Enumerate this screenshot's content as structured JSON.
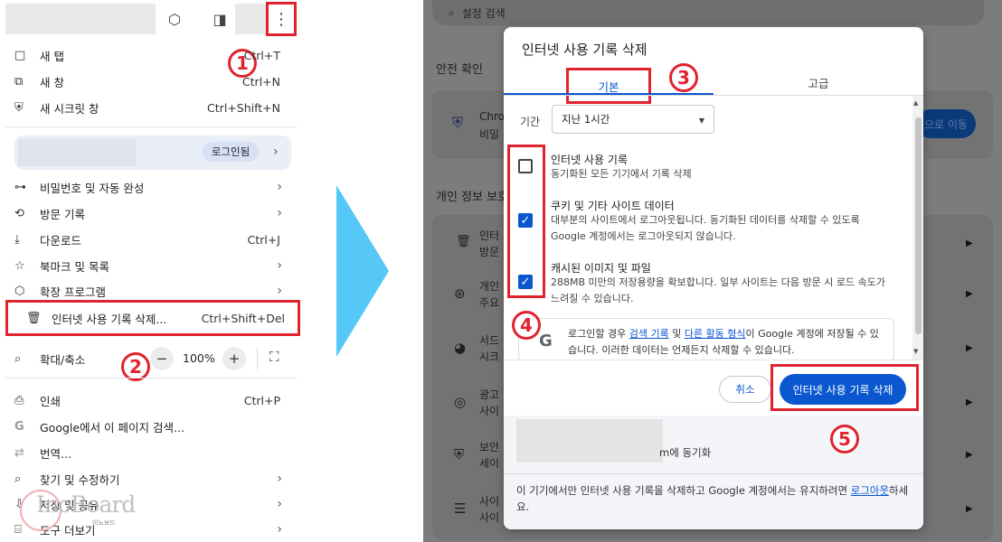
{
  "menu": {
    "items": [
      {
        "icon": "□",
        "label": "새 탭",
        "shortcut": "Ctrl+T"
      },
      {
        "icon": "⧉",
        "label": "새 창",
        "shortcut": "Ctrl+N"
      },
      {
        "icon": "⛨",
        "label": "새 시크릿 창",
        "shortcut": "Ctrl+Shift+N"
      },
      {
        "icon": "⊶",
        "label": "비밀번호 및 자동 완성",
        "shortcut": ""
      },
      {
        "icon": "⟲",
        "label": "방문 기록",
        "shortcut": ""
      },
      {
        "icon": "⤓",
        "label": "다운로드",
        "shortcut": "Ctrl+J"
      },
      {
        "icon": "☆",
        "label": "북마크 및 목록",
        "shortcut": ""
      },
      {
        "icon": "⬡",
        "label": "확장 프로그램",
        "shortcut": ""
      },
      {
        "icon": "🗑",
        "label": "인터넷 사용 기록 삭제...",
        "shortcut": "Ctrl+Shift+Del"
      },
      {
        "icon": "⌕",
        "label": "확대/축소",
        "shortcut": ""
      },
      {
        "icon": "⎙",
        "label": "인쇄",
        "shortcut": "Ctrl+P"
      },
      {
        "icon": "G",
        "label": "Google에서 이 페이지 검색...",
        "shortcut": ""
      },
      {
        "icon": "⇄",
        "label": "번역...",
        "shortcut": ""
      },
      {
        "icon": "⌕",
        "label": "찾기 및 수정하기",
        "shortcut": ""
      },
      {
        "icon": "⇩",
        "label": "저장 및 공유",
        "shortcut": ""
      },
      {
        "icon": "⌸",
        "label": "도구 더보기",
        "shortcut": ""
      }
    ],
    "login_label": "로그인됨",
    "zoom": {
      "minus": "−",
      "value": "100%",
      "plus": "+"
    },
    "arrow_glyph": "›"
  },
  "steps": [
    "1",
    "2",
    "3",
    "4",
    "5"
  ],
  "settings": {
    "search_placeholder": "설정 검색",
    "safety_check": "안전 확인",
    "safety_row_title": "Chro",
    "safety_row_sub": "비밀",
    "safety_btn": "으로 이동",
    "privacy_heading": "개인 정보 보호",
    "rows": [
      {
        "t": "인터",
        "s": "방문"
      },
      {
        "t": "개인",
        "s": "주요"
      },
      {
        "t": "서드",
        "s": "시크"
      },
      {
        "t": "광고",
        "s": "사이"
      },
      {
        "t": "보안",
        "s": "세이"
      },
      {
        "t": "사이",
        "s": "사이"
      }
    ]
  },
  "dialog": {
    "title": "인터넷 사용 기록 삭제",
    "tab_basic": "기본",
    "tab_advanced": "고급",
    "period_label": "기간",
    "period_value": "지난 1시간",
    "options": [
      {
        "title": "인터넷 사용 기록",
        "desc": "동기화된 모든 기기에서 기록 삭제",
        "checked": false
      },
      {
        "title": "쿠키 및 기타 사이트 데이터",
        "desc": "대부분의 사이트에서 로그아웃됩니다. 동기화된 데이터를 삭제할 수 있도록 Google 계정에서는 로그아웃되지 않습니다.",
        "checked": true
      },
      {
        "title": "캐시된 이미지 및 파일",
        "desc": "288MB 미만의 저장용량을 확보합니다. 일부 사이트는 다음 방문 시 로드 속도가 느려질 수 있습니다.",
        "checked": true
      }
    ],
    "info_prefix": "로그인할 경우 ",
    "info_link1": "검색 기록",
    "info_mid": " 및 ",
    "info_link2": "다른 활동 형식",
    "info_suffix": "이 Google 계정에 저장될 수 있습니다. 이러한 데이터는 언제든지 삭제할 수 있습니다.",
    "cancel": "취소",
    "delete": "인터넷 사용 기록 삭제",
    "sync_suffix": "m에 동기화",
    "footer_prefix": "이 기기에서만 인터넷 사용 기록을 삭제하고 Google 계정에서는 유지하려면 ",
    "footer_link": "로그아웃",
    "footer_suffix": "하세요."
  },
  "logo": {
    "text": "InoBoard",
    "sub": "이노보드"
  },
  "colors": {
    "accent": "#0b57d0",
    "highlight": "#e0232e",
    "arrow": "#55c8f7"
  }
}
